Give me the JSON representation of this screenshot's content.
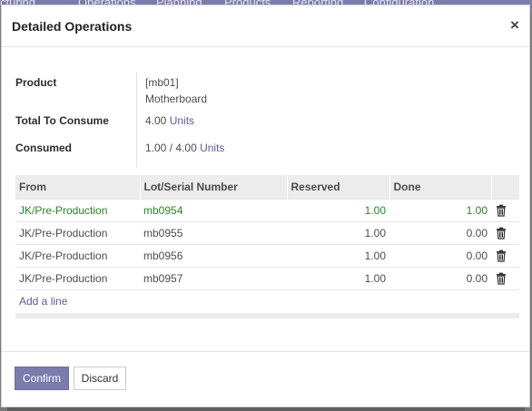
{
  "background_app": {
    "brand_fragment": "cturing",
    "menu": [
      "Operations",
      "Planning",
      "Products",
      "Reporting",
      "Configuration"
    ],
    "nav_color": "#7c7bad"
  },
  "dialog": {
    "title": "Detailed Operations",
    "close_glyph": "×"
  },
  "fields": {
    "product_label": "Product",
    "product_code": "[mb01]",
    "product_name": "Motherboard",
    "total_label": "Total To Consume",
    "total_qty": "4.00",
    "total_uom": "Units",
    "consumed_label": "Consumed",
    "consumed_qty": "1.00",
    "consumed_sep": "/",
    "consumed_total": "4.00",
    "consumed_uom": "Units"
  },
  "table": {
    "headers": {
      "from": "From",
      "lot": "Lot/Serial Number",
      "reserved": "Reserved",
      "done": "Done"
    },
    "rows": [
      {
        "from": "JK/Pre-Production",
        "lot": "mb0954",
        "reserved": "1.00",
        "done": "1.00",
        "highlight": true
      },
      {
        "from": "JK/Pre-Production",
        "lot": "mb0955",
        "reserved": "1.00",
        "done": "0.00",
        "highlight": false
      },
      {
        "from": "JK/Pre-Production",
        "lot": "mb0956",
        "reserved": "1.00",
        "done": "0.00",
        "highlight": false
      },
      {
        "from": "JK/Pre-Production",
        "lot": "mb0957",
        "reserved": "1.00",
        "done": "0.00",
        "highlight": false
      }
    ],
    "add_line": "Add a line",
    "row_action_icon": "trash-icon",
    "highlight_color": "#288627"
  },
  "footer": {
    "confirm": "Confirm",
    "discard": "Discard",
    "primary_color": "#7c7bad"
  }
}
